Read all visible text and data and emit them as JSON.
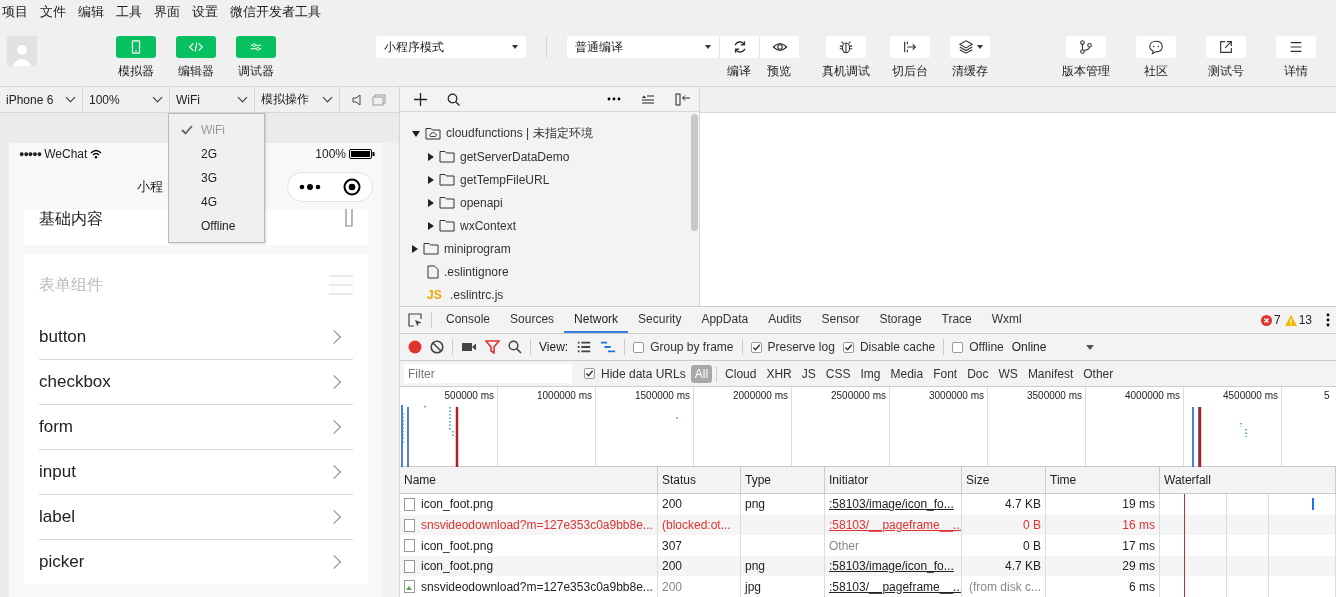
{
  "menu": [
    "项目",
    "文件",
    "编辑",
    "工具",
    "界面",
    "设置",
    "微信开发者工具"
  ],
  "toolbar": {
    "view_toggles": [
      {
        "label": "模拟器",
        "on": true
      },
      {
        "label": "编辑器",
        "on": true
      },
      {
        "label": "调试器",
        "on": true
      }
    ],
    "mode_select": "小程序模式",
    "compile_select": "普通编译",
    "compile_actions": [
      {
        "label": "编译"
      },
      {
        "label": "预览"
      }
    ],
    "actions": [
      {
        "label": "真机调试",
        "dropdown": false
      },
      {
        "label": "切后台",
        "dropdown": false
      },
      {
        "label": "清缓存",
        "dropdown": true
      }
    ],
    "right_actions": [
      {
        "label": "版本管理"
      },
      {
        "label": "社区"
      },
      {
        "label": "测试号"
      },
      {
        "label": "详情"
      }
    ]
  },
  "simulator_bar": {
    "selects": [
      {
        "label": "iPhone 6"
      },
      {
        "label": "100%"
      },
      {
        "label": "WiFi",
        "options": [
          {
            "label": "WiFi",
            "selected": true
          },
          {
            "label": "2G",
            "selected": false
          },
          {
            "label": "3G",
            "selected": false
          },
          {
            "label": "4G",
            "selected": false
          },
          {
            "label": "Offline",
            "selected": false
          }
        ]
      },
      {
        "label": "模拟操作"
      }
    ]
  },
  "phone": {
    "signal": "●●●●●",
    "carrier": "WeChat",
    "battery": "100%",
    "title": "小程",
    "sections": [
      {
        "title": "基础内容",
        "expanded": false
      },
      {
        "title": "表单组件",
        "expanded": true,
        "items": [
          "button",
          "checkbox",
          "form",
          "input",
          "label",
          "picker"
        ]
      }
    ]
  },
  "file_tree": [
    {
      "label": "cloudfunctions | 未指定环境",
      "kind": "cloud-folder",
      "expanded": true,
      "children": [
        {
          "label": "getServerDataDemo",
          "kind": "folder",
          "expanded": false
        },
        {
          "label": "getTempFileURL",
          "kind": "folder",
          "expanded": false
        },
        {
          "label": "openapi",
          "kind": "folder",
          "expanded": false
        },
        {
          "label": "wxContext",
          "kind": "folder",
          "expanded": false
        }
      ]
    },
    {
      "label": "miniprogram",
      "kind": "folder",
      "expanded": false
    },
    {
      "label": ".eslintignore",
      "kind": "file"
    },
    {
      "label": ".eslintrc.js",
      "kind": "js",
      "badge": "JS"
    }
  ],
  "devtools": {
    "tabs": [
      {
        "label": "Console",
        "selected": false
      },
      {
        "label": "Sources",
        "selected": false
      },
      {
        "label": "Network",
        "selected": true
      },
      {
        "label": "Security",
        "selected": false
      },
      {
        "label": "AppData",
        "selected": false
      },
      {
        "label": "Audits",
        "selected": false
      },
      {
        "label": "Sensor",
        "selected": false
      },
      {
        "label": "Storage",
        "selected": false
      },
      {
        "label": "Trace",
        "selected": false
      },
      {
        "label": "Wxml",
        "selected": false
      }
    ],
    "errors": "7",
    "warnings": "13",
    "network": {
      "recording": true,
      "filter_active": true,
      "view_label": "View:",
      "views": [
        {
          "selected": false
        },
        {
          "selected": true
        }
      ],
      "option_groups": [
        [
          {
            "label": "Group by frame",
            "checked": false
          }
        ],
        [
          {
            "label": "Preserve log",
            "checked": true
          },
          {
            "label": "Disable cache",
            "checked": true
          }
        ],
        [
          {
            "label": "Offline",
            "checked": false
          }
        ]
      ],
      "throttle": "Online",
      "filter_placeholder": "Filter",
      "hide_data_urls": {
        "label": "Hide data URLs",
        "checked": true
      },
      "types": [
        {
          "label": "All",
          "selected": true
        },
        {
          "label": "Cloud",
          "selected": false
        },
        {
          "label": "XHR",
          "selected": false
        },
        {
          "label": "JS",
          "selected": false
        },
        {
          "label": "CSS",
          "selected": false
        },
        {
          "label": "Img",
          "selected": false
        },
        {
          "label": "Media",
          "selected": false
        },
        {
          "label": "Font",
          "selected": false
        },
        {
          "label": "Doc",
          "selected": false
        },
        {
          "label": "WS",
          "selected": false
        },
        {
          "label": "Manifest",
          "selected": false
        },
        {
          "label": "Other",
          "selected": false
        }
      ],
      "overview_ticks": [
        "500000 ms",
        "1000000 ms",
        "1500000 ms",
        "2000000 ms",
        "2500000 ms",
        "3000000 ms",
        "3500000 ms",
        "4000000 ms",
        "4500000 ms",
        "5"
      ],
      "columns": [
        "Name",
        "Status",
        "Type",
        "Initiator",
        "Size",
        "Time",
        "Waterfall"
      ],
      "rows": [
        {
          "kind": "normal",
          "name": "icon_foot.png",
          "status": "200",
          "type": "png",
          "initiator": ":58103/image/icon_fo...",
          "initiator_link": true,
          "size": "4.7 KB",
          "time": "19 ms"
        },
        {
          "kind": "blocked",
          "name": "snsvideodownload?m=127e353c0a9bb8e...",
          "status": "(blocked:ot...",
          "initiator": ":58103/__pageframe__...",
          "initiator_link": true,
          "size": "0 B",
          "time": "16 ms"
        },
        {
          "kind": "normal",
          "name": "icon_foot.png",
          "status": "307",
          "initiator": "Other",
          "initiator_link": false,
          "size": "0 B",
          "time": "17 ms"
        },
        {
          "kind": "normal",
          "name": "icon_foot.png",
          "status": "200",
          "type": "png",
          "initiator": ":58103/image/icon_fo...",
          "initiator_link": true,
          "size": "4.7 KB",
          "time": "29 ms"
        },
        {
          "kind": "cached",
          "name": "snsvideodownload?m=127e353c0a9bb8e...",
          "status": "200",
          "type": "jpg",
          "initiator": ":58103/__pageframe__...",
          "initiator_link": true,
          "size": "(from disk c...",
          "time": "6 ms"
        }
      ]
    }
  }
}
